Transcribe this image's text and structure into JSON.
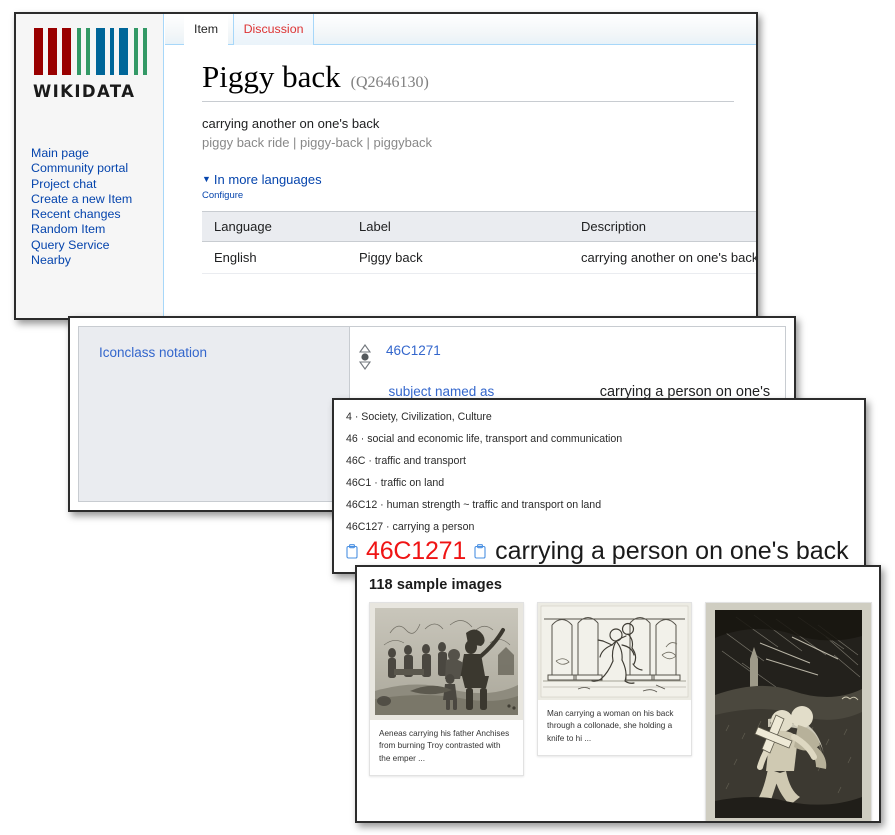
{
  "wikidata": {
    "logo": {
      "wordmark": "WIKIDATA",
      "bar_colors": [
        "#990000",
        "#990000",
        "#990000",
        "#339966",
        "#339966",
        "#006699",
        "#006699",
        "#006699",
        "#339966",
        "#339966"
      ]
    },
    "sidebar": {
      "items": [
        {
          "label": "Main page"
        },
        {
          "label": "Community portal"
        },
        {
          "label": "Project chat"
        },
        {
          "label": "Create a new Item"
        },
        {
          "label": "Recent changes"
        },
        {
          "label": "Random Item"
        },
        {
          "label": "Query Service"
        },
        {
          "label": "Nearby"
        }
      ]
    },
    "tabs": [
      {
        "label": "Item",
        "state": "active"
      },
      {
        "label": "Discussion",
        "state": "new"
      }
    ],
    "title": "Piggy back",
    "qid": "(Q2646130)",
    "description": "carrying another on one's back",
    "aliases": "piggy back ride | piggy-back | piggyback",
    "more_languages_label": "In more languages",
    "configure_label": "Configure",
    "table": {
      "headers": [
        "Language",
        "Label",
        "Description"
      ],
      "rows": [
        [
          "English",
          "Piggy back",
          "carrying another on one's back"
        ]
      ]
    }
  },
  "statement": {
    "property_label": "Iconclass notation",
    "value": "46C1271",
    "qualifier_property": "subject named as",
    "qualifier_value": "carrying a person on one's back"
  },
  "hierarchy": {
    "items": [
      "4 · Society, Civilization, Culture",
      "46 · social and economic life, transport and communication",
      "46C · traffic and transport",
      "46C1 · traffic on land",
      "46C12 · human strength ~ traffic and transport on land",
      "46C127 · carrying a person"
    ],
    "selected_code": "46C1271",
    "selected_text": "carrying a person on one's back",
    "selected_code_color": "#ef1414"
  },
  "samples": {
    "title": "118 sample images",
    "cards": [
      {
        "caption": "Aeneas carrying his father Anchises from burning Troy contrasted with the emper ..."
      },
      {
        "caption": "Man carrying a woman on his back through a collonade, she holding a knife to hi ..."
      },
      {
        "caption": ""
      }
    ]
  }
}
